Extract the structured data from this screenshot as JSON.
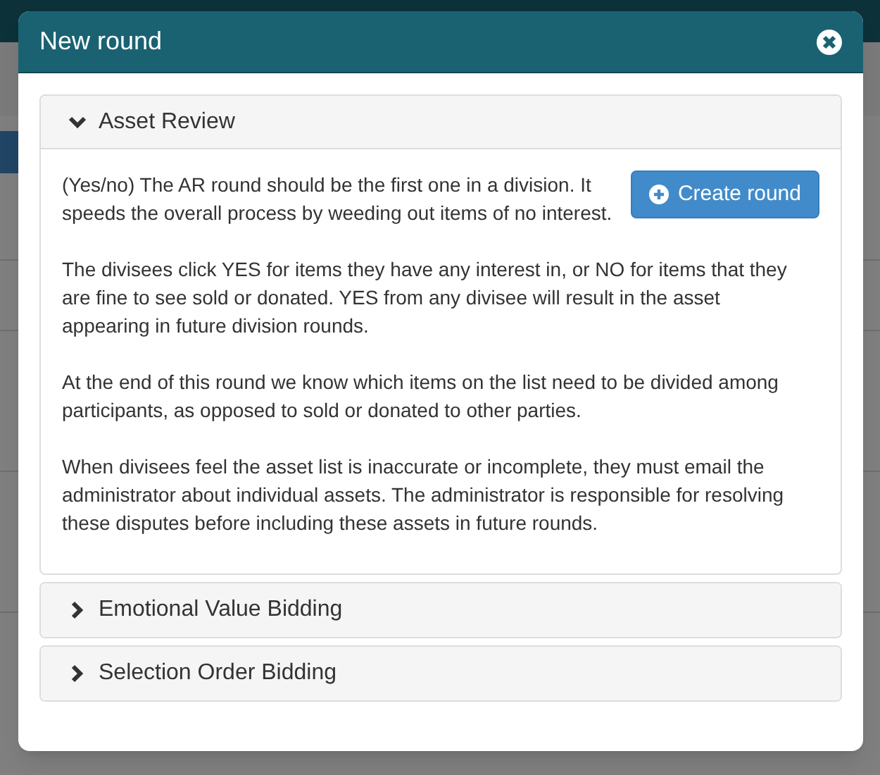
{
  "dialog": {
    "title": "New round",
    "sections": [
      {
        "title": "Asset Review",
        "expanded": true,
        "button": "Create round",
        "paragraphs": [
          "(Yes/no) The AR round should be the first one in a division. It speeds the overall process by weeding out items of no interest.",
          "The divisees click YES for items they have any interest in, or NO for items that they are fine to see sold or donated. YES from any divisee will result in the asset appearing in future division rounds.",
          "At the end of this round we know which items on the list need to be divided among participants, as opposed to sold or donated to other parties.",
          "When divisees feel the asset list is inaccurate or incomplete, they must email the administrator about individual assets. The administrator is responsible for resolving these disputes before including these assets in future rounds."
        ]
      },
      {
        "title": "Emotional Value Bidding",
        "expanded": false
      },
      {
        "title": "Selection Order Bidding",
        "expanded": false
      }
    ]
  }
}
